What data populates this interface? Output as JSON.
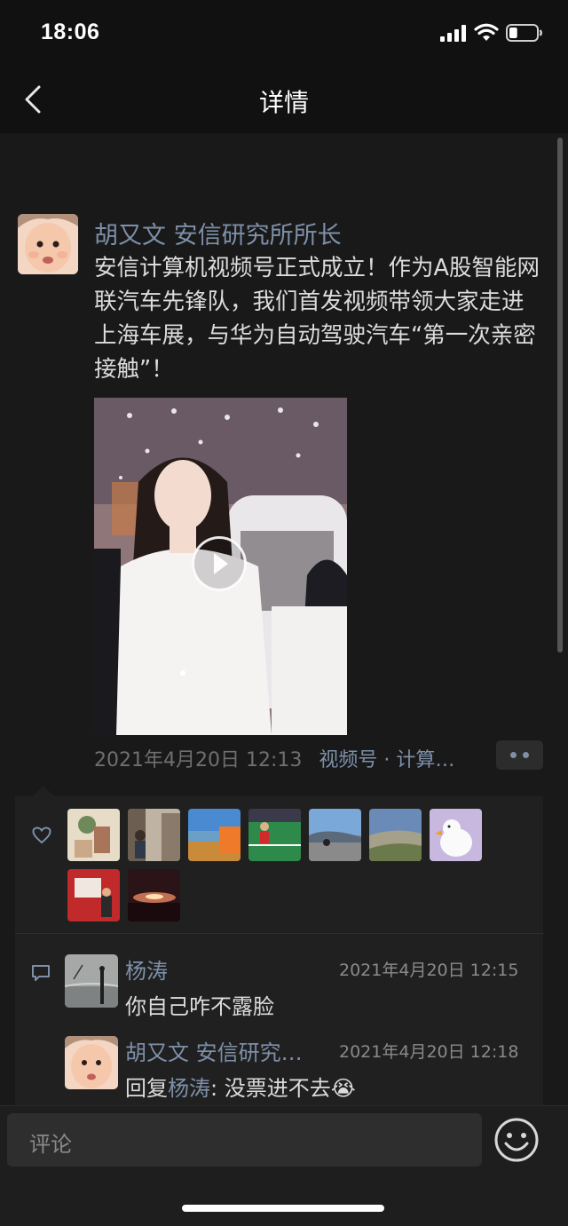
{
  "status_bar": {
    "time": "18:06",
    "battery_level": 0.3
  },
  "nav": {
    "title": "详情",
    "back_icon": "chevron-left-icon"
  },
  "post": {
    "author": "胡又文 安信研究所所长",
    "text": "安信计算机视频号正式成立！作为A股智能网联汽车先锋队，我们首发视频带领大家走进上海车展，与华为自动驾驶汽车“第一次亲密接触”！",
    "timestamp": "2021年4月20日 12:13",
    "channel": "视频号 · 计算…",
    "more_icon": "more-dots-icon",
    "play_icon": "play-icon"
  },
  "likes": {
    "icon": "heart-icon",
    "avatars": [
      "like-avatar-1",
      "like-avatar-2",
      "like-avatar-3",
      "like-avatar-4",
      "like-avatar-5",
      "like-avatar-6",
      "like-avatar-7",
      "like-avatar-8",
      "like-avatar-9"
    ]
  },
  "comments": [
    {
      "name": "杨涛",
      "time": "2021年4月20日 12:15",
      "text": "你自己咋不露脸"
    },
    {
      "name": "胡又文 安信研究…",
      "time": "2021年4月20日 12:18",
      "reply_prefix": "回复",
      "reply_to": "杨涛",
      "reply_text": ": 没票进不去😭"
    }
  ],
  "comment_icon": "comment-icon",
  "input": {
    "placeholder": "评论",
    "emoji_icon": "emoji-icon"
  },
  "colors": {
    "background": "#191919",
    "link": "#7d90a9",
    "header": "#111111"
  }
}
